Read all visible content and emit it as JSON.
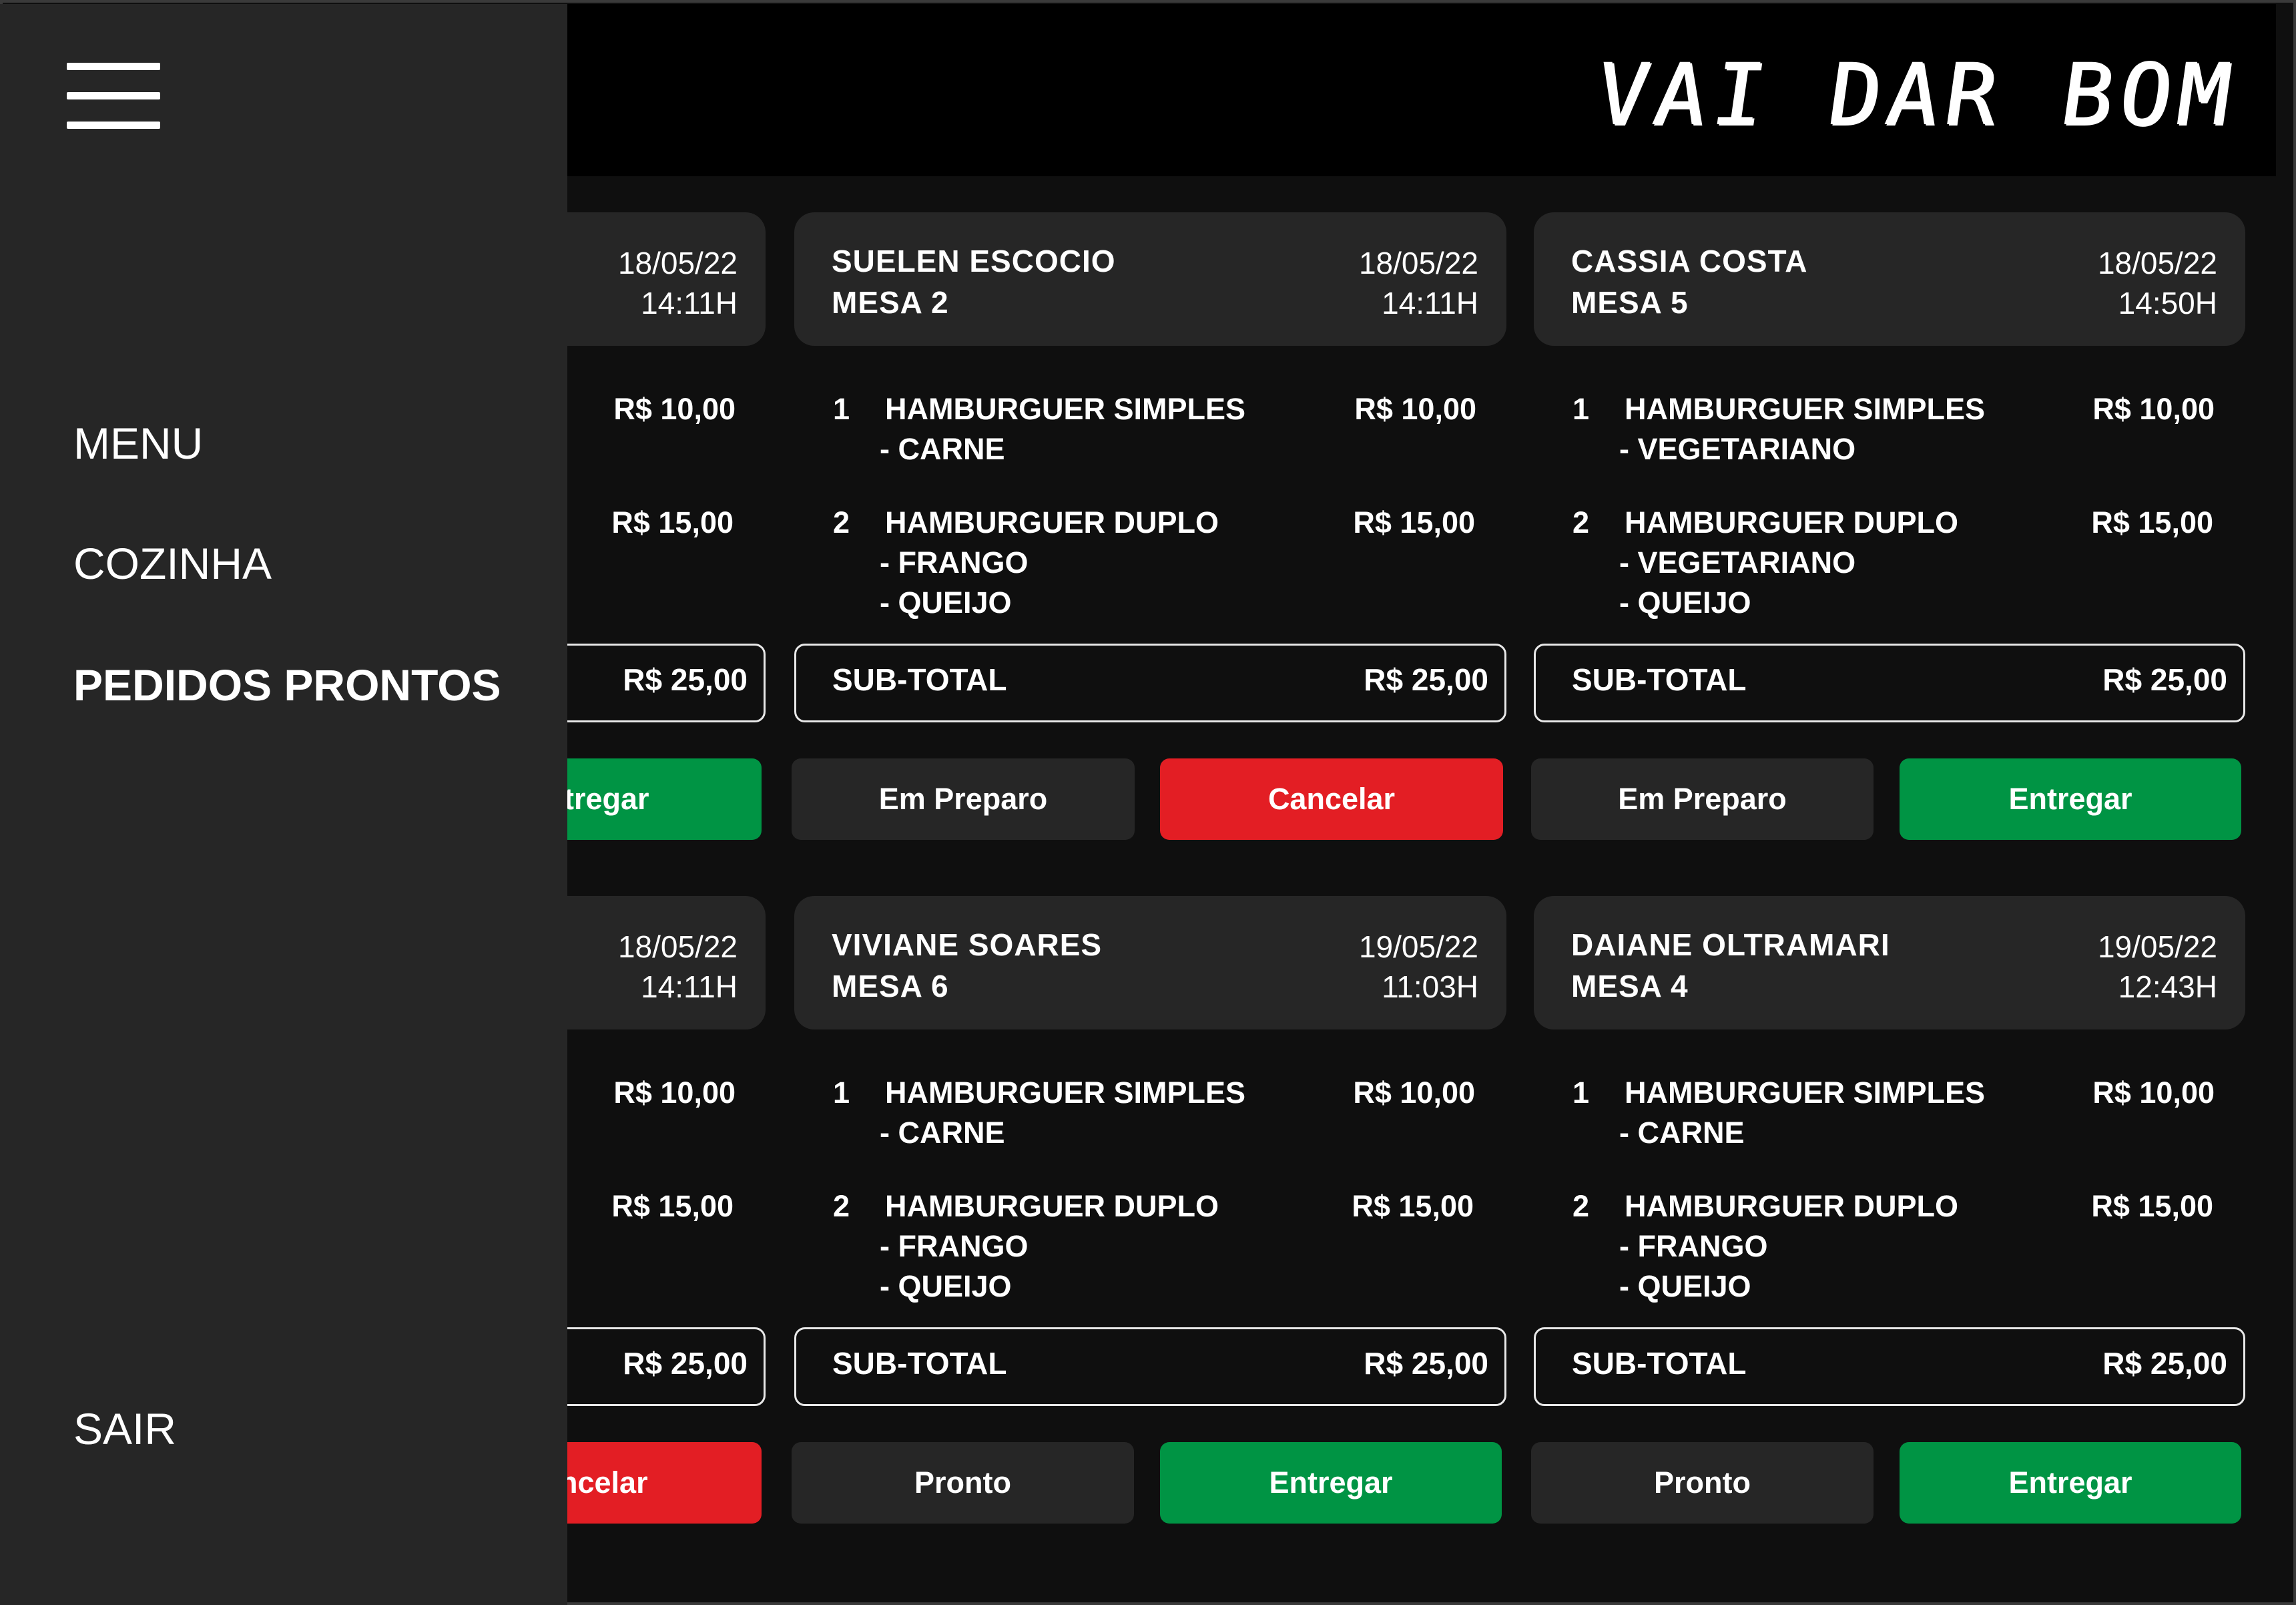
{
  "brand": "VAI DAR BOM",
  "sidebar": {
    "menu_icon": "hamburger-menu-icon",
    "items": [
      {
        "label": "MENU"
      },
      {
        "label": "COZINHA"
      },
      {
        "label": "PEDIDOS PRONTOS"
      }
    ],
    "logout": "SAIR"
  },
  "orders": {
    "r1c0": {
      "date": "18/05/22",
      "time": "14:11H",
      "prices": [
        "R$ 10,00",
        "R$ 15,00"
      ],
      "subtotal_value": "R$ 25,00",
      "button": "tregar"
    },
    "r1c1": {
      "customer": "SUELEN ESCOCIO",
      "table": "MESA 2",
      "date": "18/05/22",
      "time": "14:11H",
      "items": [
        {
          "qty": "1",
          "name": "HAMBURGUER SIMPLES",
          "mods": [
            "- CARNE"
          ],
          "price": "R$ 10,00"
        },
        {
          "qty": "2",
          "name": "HAMBURGUER DUPLO",
          "mods": [
            "- FRANGO",
            "- QUEIJO"
          ],
          "price": "R$ 15,00"
        }
      ],
      "subtotal_label": "SUB-TOTAL",
      "subtotal_value": "R$ 25,00",
      "buttons": [
        "Em Preparo",
        "Cancelar"
      ]
    },
    "r1c2": {
      "customer": "CASSIA COSTA",
      "table": "MESA 5",
      "date": "18/05/22",
      "time": "14:50H",
      "items": [
        {
          "qty": "1",
          "name": "HAMBURGUER SIMPLES",
          "mods": [
            "- VEGETARIANO"
          ],
          "price": "R$ 10,00"
        },
        {
          "qty": "2",
          "name": "HAMBURGUER DUPLO",
          "mods": [
            "- VEGETARIANO",
            "- QUEIJO"
          ],
          "price": "R$ 15,00"
        }
      ],
      "subtotal_label": "SUB-TOTAL",
      "subtotal_value": "R$ 25,00",
      "buttons": [
        "Em Preparo",
        "Entregar"
      ]
    },
    "r2c0": {
      "date": "18/05/22",
      "time": "14:11H",
      "prices": [
        "R$ 10,00",
        "R$ 15,00"
      ],
      "subtotal_value": "R$ 25,00",
      "button": "ncelar"
    },
    "r2c1": {
      "customer": "VIVIANE SOARES",
      "table": "MESA 6",
      "date": "19/05/22",
      "time": "11:03H",
      "items": [
        {
          "qty": "1",
          "name": "HAMBURGUER SIMPLES",
          "mods": [
            "- CARNE"
          ],
          "price": "R$ 10,00"
        },
        {
          "qty": "2",
          "name": "HAMBURGUER DUPLO",
          "mods": [
            "- FRANGO",
            "- QUEIJO"
          ],
          "price": "R$ 15,00"
        }
      ],
      "subtotal_label": "SUB-TOTAL",
      "subtotal_value": "R$ 25,00",
      "buttons": [
        "Pronto",
        "Entregar"
      ]
    },
    "r2c2": {
      "customer": "DAIANE OLTRAMARI",
      "table": "MESA 4",
      "date": "19/05/22",
      "time": "12:43H",
      "items": [
        {
          "qty": "1",
          "name": "HAMBURGUER SIMPLES",
          "mods": [
            "- CARNE"
          ],
          "price": "R$ 10,00"
        },
        {
          "qty": "2",
          "name": "HAMBURGUER DUPLO",
          "mods": [
            "- FRANGO",
            "- QUEIJO"
          ],
          "price": "R$ 15,00"
        }
      ],
      "subtotal_label": "SUB-TOTAL",
      "subtotal_value": "R$ 25,00",
      "buttons": [
        "Pronto",
        "Entregar"
      ]
    }
  },
  "colors": {
    "background": "#0f0f0f",
    "panel": "#262626",
    "cancel": "#e31e24",
    "deliver": "#009444"
  }
}
